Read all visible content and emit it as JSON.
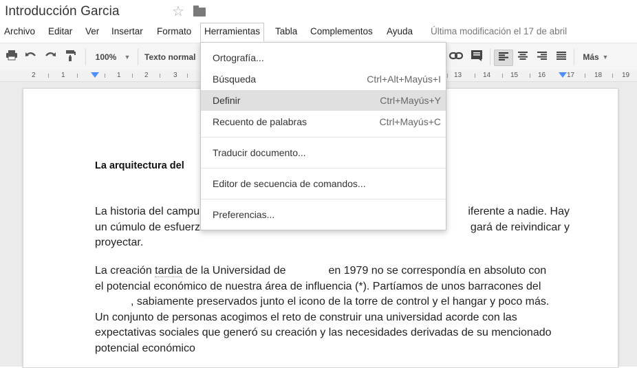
{
  "title": "Introducción Garcia",
  "menubar": {
    "items": [
      "Archivo",
      "Editar",
      "Ver",
      "Insertar",
      "Formato",
      "Herramientas",
      "Tabla",
      "Complementos",
      "Ayuda"
    ],
    "last_modified": "Última modificación el 17 de abril"
  },
  "toolbar": {
    "zoom": "100%",
    "style": "Texto normal",
    "more": "Más",
    "icons": [
      "print-icon",
      "undo-icon",
      "redo-icon",
      "paint-format-icon",
      "link-icon",
      "comment-icon",
      "align-left-icon",
      "align-center-icon",
      "align-right-icon",
      "align-justify-icon"
    ]
  },
  "ruler": {
    "labels": [
      "2",
      "1",
      "1",
      "2",
      "3",
      "13",
      "14",
      "15",
      "16",
      "17",
      "18",
      "19"
    ]
  },
  "tools_menu": {
    "items": [
      {
        "label": "Ortografía...",
        "shortcut": ""
      },
      {
        "label": "Búsqueda",
        "shortcut": "Ctrl+Alt+Mayús+I"
      },
      {
        "label": "Definir",
        "shortcut": "Ctrl+Mayús+Y"
      },
      {
        "label": "Recuento de palabras",
        "shortcut": "Ctrl+Mayús+C"
      },
      {
        "label": "Traducir documento...",
        "shortcut": ""
      },
      {
        "label": "Editor de secuencia de comandos...",
        "shortcut": ""
      },
      {
        "label": "Preferencias...",
        "shortcut": ""
      }
    ],
    "highlighted": "Definir"
  },
  "document": {
    "heading": "La arquitectura del",
    "p1": {
      "line1_a": "La historia del campu",
      "line1_b": "iferente a nadie. Hay",
      "line2_a": "un cúmulo de esfuerz",
      "line2_b": "gará de reivindicar y",
      "line3": "proyectar."
    },
    "p2": {
      "l1_a": "La creación ",
      "l1_word": "tardia",
      "l1_b": " de la Universidad de",
      "l1_c": "en 1979 no se correspondía en absoluto con",
      "l2": "el potencial económico de nuestra área de influencia (*). Partíamos de unos barracones del",
      "l3": ", sabiamente preservados junto el icono de la torre de control y el hangar y poco más.",
      "l4": "Un conjunto de personas acogimos el reto de construir una universidad acorde con las",
      "l5": "expectativas sociales que generó su creación y las necesidades derivadas de su mencionado",
      "l6": "potencial económico"
    }
  },
  "colors": {
    "accent": "#4d90fe",
    "menu_highlight": "#e0e0e0",
    "toolbar_bg": "#f5f5f5"
  }
}
